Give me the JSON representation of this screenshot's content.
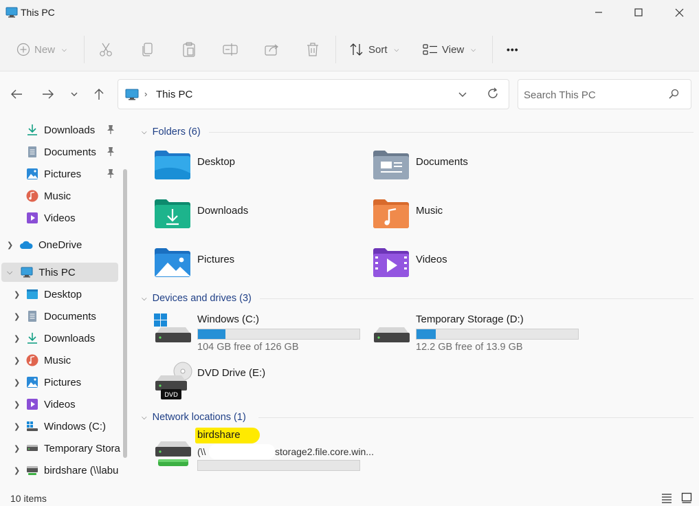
{
  "window": {
    "title": "This PC",
    "minimize": "minimize",
    "maximize": "maximize",
    "close": "close"
  },
  "toolbar": {
    "new_label": "New",
    "sort_label": "Sort",
    "view_label": "View",
    "more_label": "•••"
  },
  "address": {
    "location": "This PC"
  },
  "search": {
    "placeholder": "Search This PC"
  },
  "sidebar": {
    "quick_access": [
      {
        "label": "Downloads",
        "pinned": true
      },
      {
        "label": "Documents",
        "pinned": true
      },
      {
        "label": "Pictures",
        "pinned": true
      },
      {
        "label": "Music",
        "pinned": false
      },
      {
        "label": "Videos",
        "pinned": false
      }
    ],
    "onedrive": "OneDrive",
    "this_pc": "This PC",
    "this_pc_children": [
      "Desktop",
      "Documents",
      "Downloads",
      "Music",
      "Pictures",
      "Videos",
      "Windows (C:)",
      "Temporary Stora",
      "birdshare (\\\\labu"
    ]
  },
  "groups": {
    "folders": {
      "header": "Folders (6)",
      "items": [
        "Desktop",
        "Documents",
        "Downloads",
        "Music",
        "Pictures",
        "Videos"
      ]
    },
    "devices": {
      "header": "Devices and drives (3)",
      "drives": [
        {
          "name": "Windows (C:)",
          "free": "104 GB free of 126 GB",
          "used_fraction": 0.17
        },
        {
          "name": "Temporary Storage (D:)",
          "free": "12.2 GB free of 13.9 GB",
          "used_fraction": 0.12
        }
      ],
      "dvd": {
        "name": "DVD Drive (E:)",
        "badge": "DVD"
      }
    },
    "network": {
      "header": "Network locations (1)",
      "item": {
        "name": "birdshare",
        "path_start": "(\\\\",
        "path_end": "storage2.file.core.win..."
      }
    }
  },
  "status": {
    "count": "10 items"
  },
  "colors": {
    "accent": "#2690d6",
    "header_text": "#1f3f86",
    "highlight": "#ffea00"
  }
}
